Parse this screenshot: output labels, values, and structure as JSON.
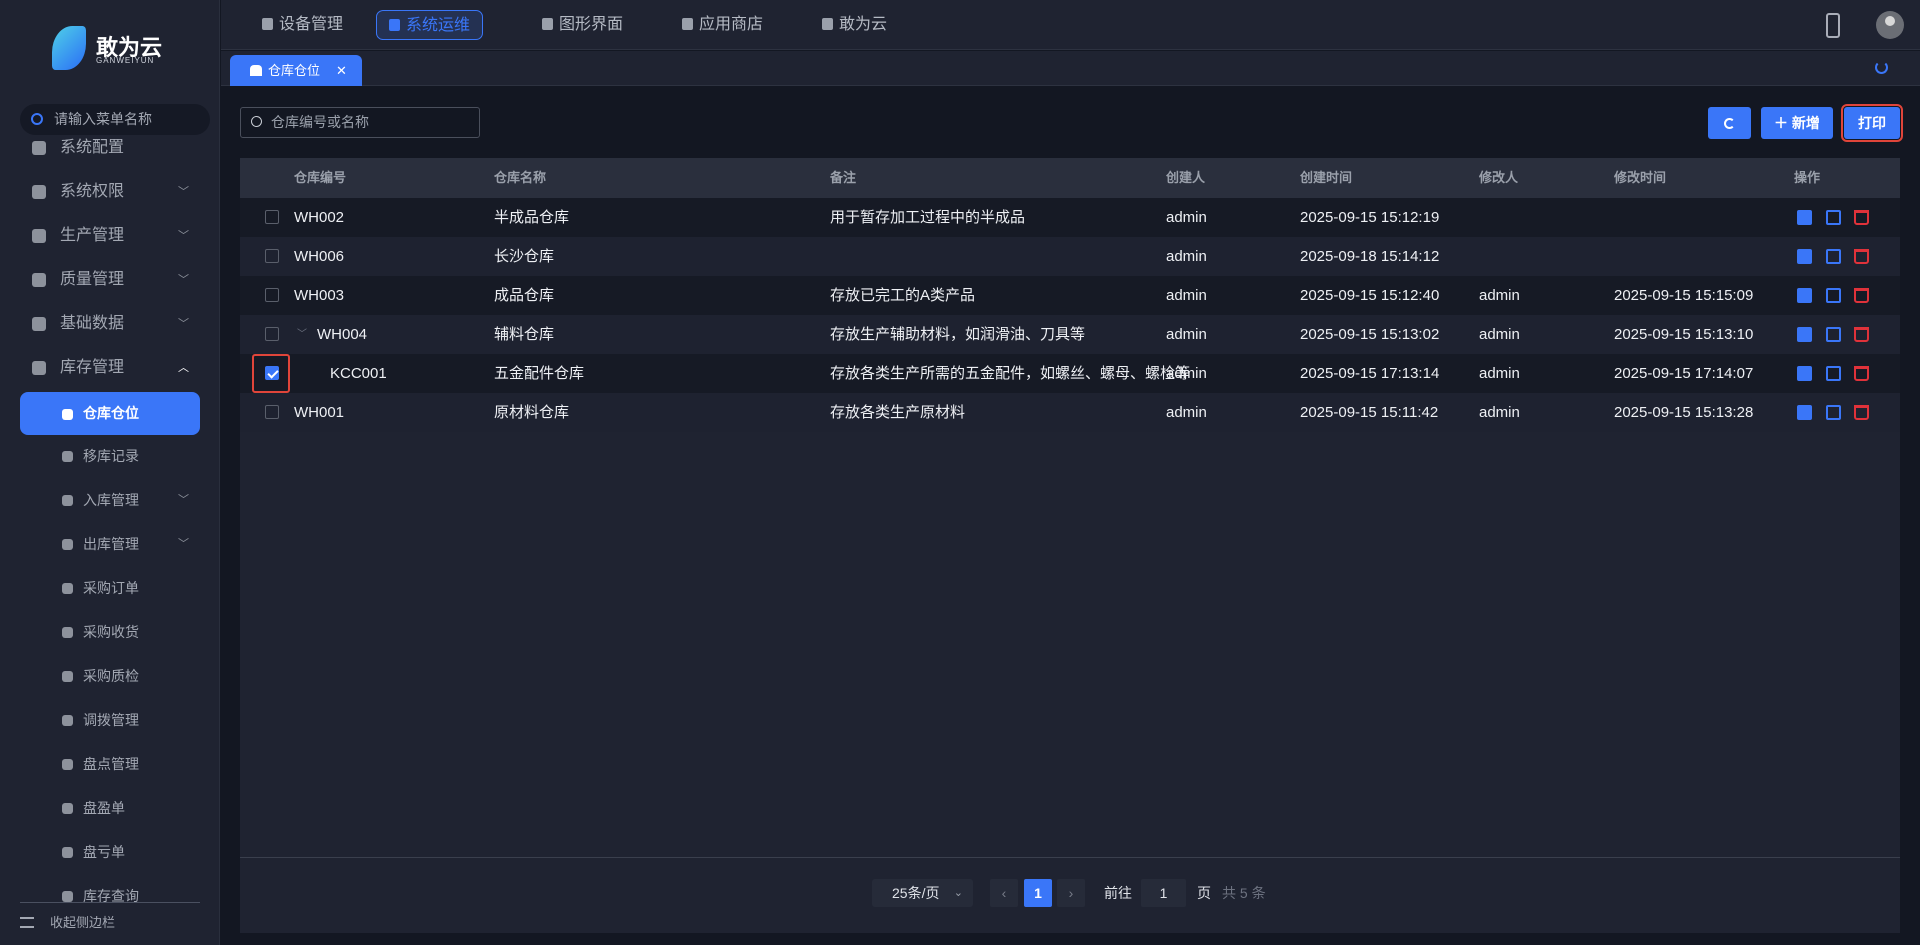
{
  "brand": {
    "name": "敢为云",
    "sub": "GANWEIYUN"
  },
  "sidebar": {
    "search_placeholder": "请输入菜单名称",
    "items": [
      {
        "label": "系统配置",
        "level": 0,
        "icon": "grid-icon"
      },
      {
        "label": "系统权限",
        "level": 0,
        "icon": "shield-key-icon",
        "chevron": "down"
      },
      {
        "label": "生产管理",
        "level": 0,
        "icon": "boxes-icon",
        "chevron": "down"
      },
      {
        "label": "质量管理",
        "level": 0,
        "icon": "shield-check-icon",
        "chevron": "down"
      },
      {
        "label": "基础数据",
        "level": 0,
        "icon": "database-icon",
        "chevron": "down"
      },
      {
        "label": "库存管理",
        "level": 0,
        "icon": "warehouse-icon",
        "chevron": "up"
      },
      {
        "label": "仓库仓位",
        "level": 1,
        "icon": "warehouse-icon",
        "active": true
      },
      {
        "label": "移库记录",
        "level": 1,
        "icon": "transfer-icon"
      },
      {
        "label": "入库管理",
        "level": 1,
        "icon": "inbound-icon",
        "chevron": "down"
      },
      {
        "label": "出库管理",
        "level": 1,
        "icon": "outbound-icon",
        "chevron": "down"
      },
      {
        "label": "采购订单",
        "level": 1,
        "icon": "cart-icon"
      },
      {
        "label": "采购收货",
        "level": 1,
        "icon": "package-icon"
      },
      {
        "label": "采购质检",
        "level": 1,
        "icon": "inspect-icon"
      },
      {
        "label": "调拨管理",
        "level": 1,
        "icon": "clipboard-icon"
      },
      {
        "label": "盘点管理",
        "level": 1,
        "icon": "house-icon"
      },
      {
        "label": "盘盈单",
        "level": 1,
        "icon": "house-icon"
      },
      {
        "label": "盘亏单",
        "level": 1,
        "icon": "house-icon"
      },
      {
        "label": "库存查询",
        "level": 1,
        "icon": "doc-search-icon"
      }
    ],
    "collapse_label": "收起侧边栏"
  },
  "topnav": {
    "tabs": [
      {
        "label": "设备管理",
        "icon": "device-icon"
      },
      {
        "label": "系统运维",
        "icon": "wrench-icon",
        "active": true
      },
      {
        "label": "图形界面",
        "icon": "monitor-icon"
      },
      {
        "label": "应用商店",
        "icon": "store-icon"
      },
      {
        "label": "敢为云",
        "icon": "butterfly-icon"
      }
    ]
  },
  "tabbar": {
    "tab_label": "仓库仓位",
    "close": "✕"
  },
  "toolbar": {
    "search_placeholder": "仓库编号或名称",
    "add_label": "＋ 新增",
    "print_label": "打印"
  },
  "table": {
    "columns": [
      "仓库编号",
      "仓库名称",
      "备注",
      "创建人",
      "创建时间",
      "修改人",
      "修改时间",
      "操作"
    ],
    "rows": [
      {
        "code": "WH002",
        "name": "半成品仓库",
        "remark": "用于暂存加工过程中的半成品",
        "creator": "admin",
        "created": "2025-09-15 15:12:19",
        "modifier": "",
        "modified": "",
        "checked": false,
        "level": 0
      },
      {
        "code": "WH006",
        "name": "长沙仓库",
        "remark": "",
        "creator": "admin",
        "created": "2025-09-18 15:14:12",
        "modifier": "",
        "modified": "",
        "checked": false,
        "level": 0
      },
      {
        "code": "WH003",
        "name": "成品仓库",
        "remark": "存放已完工的A类产品",
        "creator": "admin",
        "created": "2025-09-15 15:12:40",
        "modifier": "admin",
        "modified": "2025-09-15 15:15:09",
        "checked": false,
        "level": 0
      },
      {
        "code": "WH004",
        "name": "辅料仓库",
        "remark": "存放生产辅助材料，如润滑油、刀具等",
        "creator": "admin",
        "created": "2025-09-15 15:13:02",
        "modifier": "admin",
        "modified": "2025-09-15 15:13:10",
        "checked": false,
        "level": 0,
        "expanded": true
      },
      {
        "code": "KCC001",
        "name": "五金配件仓库",
        "remark": "存放各类生产所需的五金配件，如螺丝、螺母、螺栓等",
        "creator": "admin",
        "created": "2025-09-15 17:13:14",
        "modifier": "admin",
        "modified": "2025-09-15 17:14:07",
        "checked": true,
        "level": 1
      },
      {
        "code": "WH001",
        "name": "原材料仓库",
        "remark": "存放各类生产原材料",
        "creator": "admin",
        "created": "2025-09-15 15:11:42",
        "modifier": "admin",
        "modified": "2025-09-15 15:13:28",
        "checked": false,
        "level": 0
      }
    ]
  },
  "pagination": {
    "page_size": "25条/页",
    "current": "1",
    "goto_label": "前往",
    "goto_value": "1",
    "page_unit": "页",
    "total": "共 5 条"
  },
  "colors": {
    "accent": "#3a76f8",
    "danger": "#e0323a",
    "highlight": "#e0453a"
  }
}
